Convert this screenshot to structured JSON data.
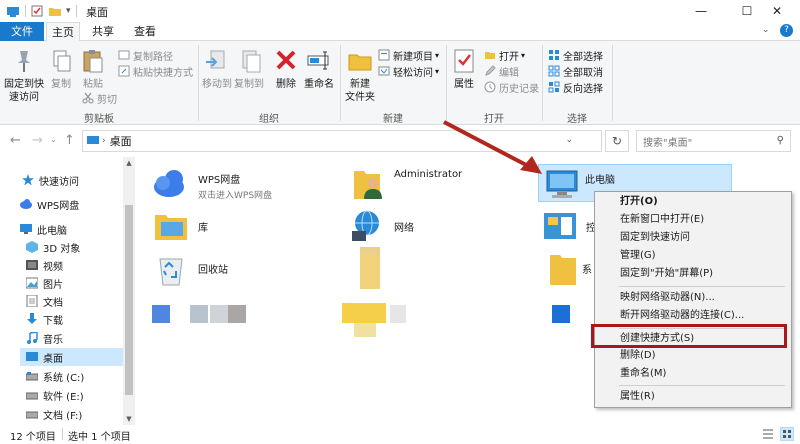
{
  "window": {
    "title": "桌面",
    "controls": {
      "minimize": "—",
      "maximize": "☐",
      "close": "✕"
    }
  },
  "tabs": {
    "file": "文件",
    "home": "主页",
    "share": "共享",
    "view": "查看"
  },
  "ribbon": {
    "clipboard": {
      "label": "剪贴板",
      "pin": "固定到快\n速访问",
      "copy": "复制",
      "paste": "粘贴",
      "copy_path": "复制路径",
      "paste_shortcut": "粘贴快捷方式",
      "cut": "剪切"
    },
    "organize": {
      "label": "组织",
      "move_to": "移动到",
      "copy_to": "复制到",
      "delete": "删除",
      "rename": "重命名"
    },
    "new": {
      "label": "新建",
      "new_folder": "新建\n文件夹",
      "new_item": "新建项目",
      "easy_access": "轻松访问"
    },
    "open": {
      "label": "打开",
      "properties": "属性",
      "open": "打开",
      "edit": "编辑",
      "history": "历史记录"
    },
    "select": {
      "label": "选择",
      "select_all": "全部选择",
      "select_none": "全部取消",
      "invert": "反向选择"
    }
  },
  "address": {
    "path": "桌面",
    "search_placeholder": "搜索\"桌面\""
  },
  "nav": {
    "items": [
      {
        "label": "快速访问",
        "icon": "star-icon"
      },
      {
        "label": "WPS网盘",
        "icon": "cloud-icon"
      },
      {
        "label": "此电脑",
        "icon": "computer-icon"
      },
      {
        "label": "3D 对象",
        "icon": "cube-icon"
      },
      {
        "label": "视频",
        "icon": "video-icon"
      },
      {
        "label": "图片",
        "icon": "picture-icon"
      },
      {
        "label": "文档",
        "icon": "document-icon"
      },
      {
        "label": "下载",
        "icon": "download-icon"
      },
      {
        "label": "音乐",
        "icon": "music-icon"
      },
      {
        "label": "桌面",
        "icon": "desktop-icon"
      },
      {
        "label": "系统 (C:)",
        "icon": "drive-icon"
      },
      {
        "label": "软件 (E:)",
        "icon": "drive-icon"
      },
      {
        "label": "文档 (F:)",
        "icon": "drive-icon"
      }
    ]
  },
  "files": {
    "wps": {
      "name": "WPS网盘",
      "sub": "双击进入WPS网盘"
    },
    "admin": {
      "name": "Administrator"
    },
    "thispc": {
      "name": "此电脑"
    },
    "lib": {
      "name": "库"
    },
    "network": {
      "name": "网络"
    },
    "control": {
      "name": "控"
    },
    "recycle": {
      "name": "回收站"
    },
    "sys": {
      "name": "系"
    }
  },
  "context_menu": {
    "open": "打开(O)",
    "open_new_window": "在新窗口中打开(E)",
    "pin_quick": "固定到快速访问",
    "manage": "管理(G)",
    "pin_start": "固定到\"开始\"屏幕(P)",
    "map_drive": "映射网络驱动器(N)...",
    "disconnect_drive": "断开网络驱动器的连接(C)...",
    "create_shortcut": "创建快捷方式(S)",
    "delete": "删除(D)",
    "rename": "重命名(M)",
    "properties": "属性(R)"
  },
  "status": {
    "count": "12 个项目",
    "selected": "选中 1 个项目"
  },
  "colors": {
    "accent": "#1979ca",
    "selection": "#cce8ff",
    "highlight_box": "#a8171a",
    "arrow": "#b3261e"
  }
}
